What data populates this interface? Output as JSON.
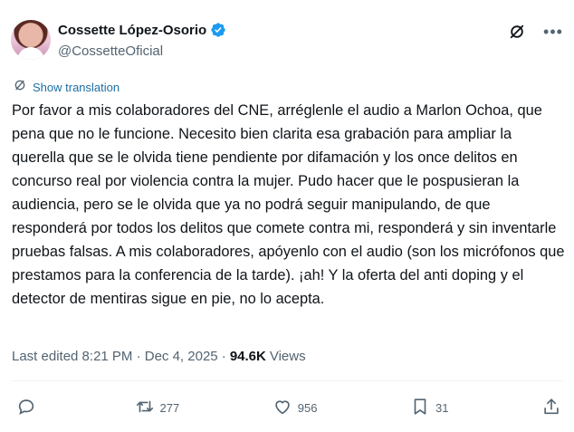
{
  "author": {
    "display_name": "Cossette López-Osorio",
    "handle": "@CossetteOficial",
    "verified": true
  },
  "translate_label": "Show translation",
  "tweet_text": "Por favor a mis colaboradores del CNE, arrégl​enle el audio a Marlon Ochoa, que pena que no le funcione.  Necesito bien clarita esa grabación para ampliar la querella que se le olvida tiene pendiente por difamación y los once delitos en concurso real por violencia contra la mujer. Pudo hacer que le pospusieran la audiencia, pero se le olvida que ya no podrá seguir manipulando, de que responderá por todos los delitos que comete contra mi, responderá y sin inventarle pruebas falsas. A mis colaboradores, apóyenlo con el audio (son los micrófonos que prestamos para la conferencia de la tarde). ¡ah! Y la oferta del anti doping y el detector de mentiras sigue en pie, no lo acepta.",
  "meta": {
    "edited_label": "Last edited 8:21 PM · Dec 4, 2025 ·",
    "views_count": "94.6K",
    "views_label": "Views"
  },
  "actions": {
    "reply_count": "",
    "retweet_count": "277",
    "like_count": "956",
    "bookmark_count": "31"
  },
  "colors": {
    "text": "#0f1419",
    "secondary": "#536471",
    "link": "#1d6fa5",
    "verified": "#1d9bf0"
  },
  "icons": [
    "verified-badge-icon",
    "grok-icon",
    "more-icon",
    "translate-icon",
    "reply-icon",
    "retweet-icon",
    "like-icon",
    "bookmark-icon",
    "share-icon"
  ]
}
